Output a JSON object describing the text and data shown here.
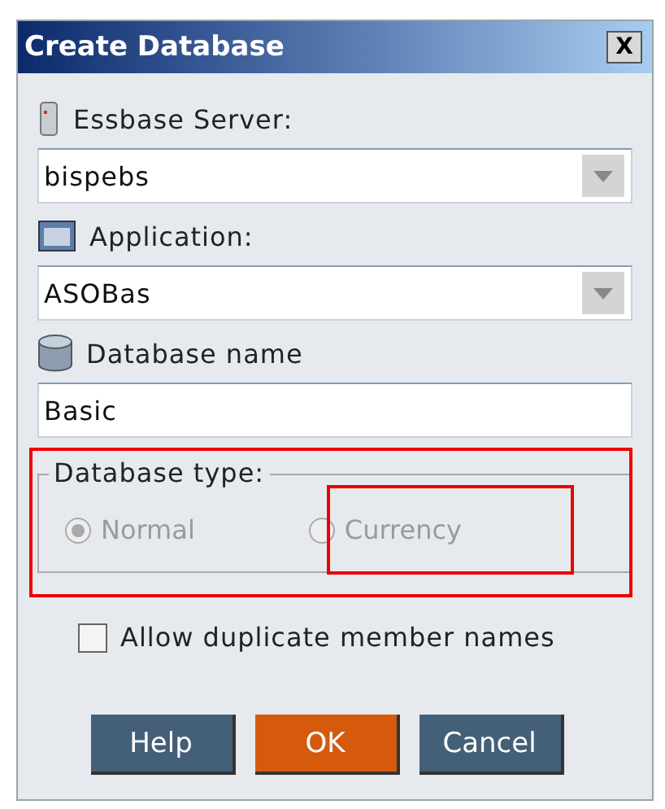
{
  "window": {
    "title": "Create Database",
    "close": "X"
  },
  "fields": [
    {
      "kind": "dropdown",
      "label": "Essbase Server:",
      "value": "bispebs"
    },
    {
      "kind": "dropdown",
      "label": "Application:",
      "value": "ASOBas"
    },
    {
      "kind": "text",
      "label": "Database name",
      "value": "Basic"
    }
  ],
  "database_type": {
    "label": "Database type:",
    "disabled": true,
    "options": [
      {
        "label": "Normal",
        "selected": true
      },
      {
        "label": "Currency",
        "selected": false
      }
    ]
  },
  "allow_duplicates": {
    "label": "Allow duplicate member names",
    "checked": false
  },
  "buttons": [
    {
      "label": "Help",
      "primary": false
    },
    {
      "label": "OK",
      "primary": true
    },
    {
      "label": "Cancel",
      "primary": false
    }
  ]
}
